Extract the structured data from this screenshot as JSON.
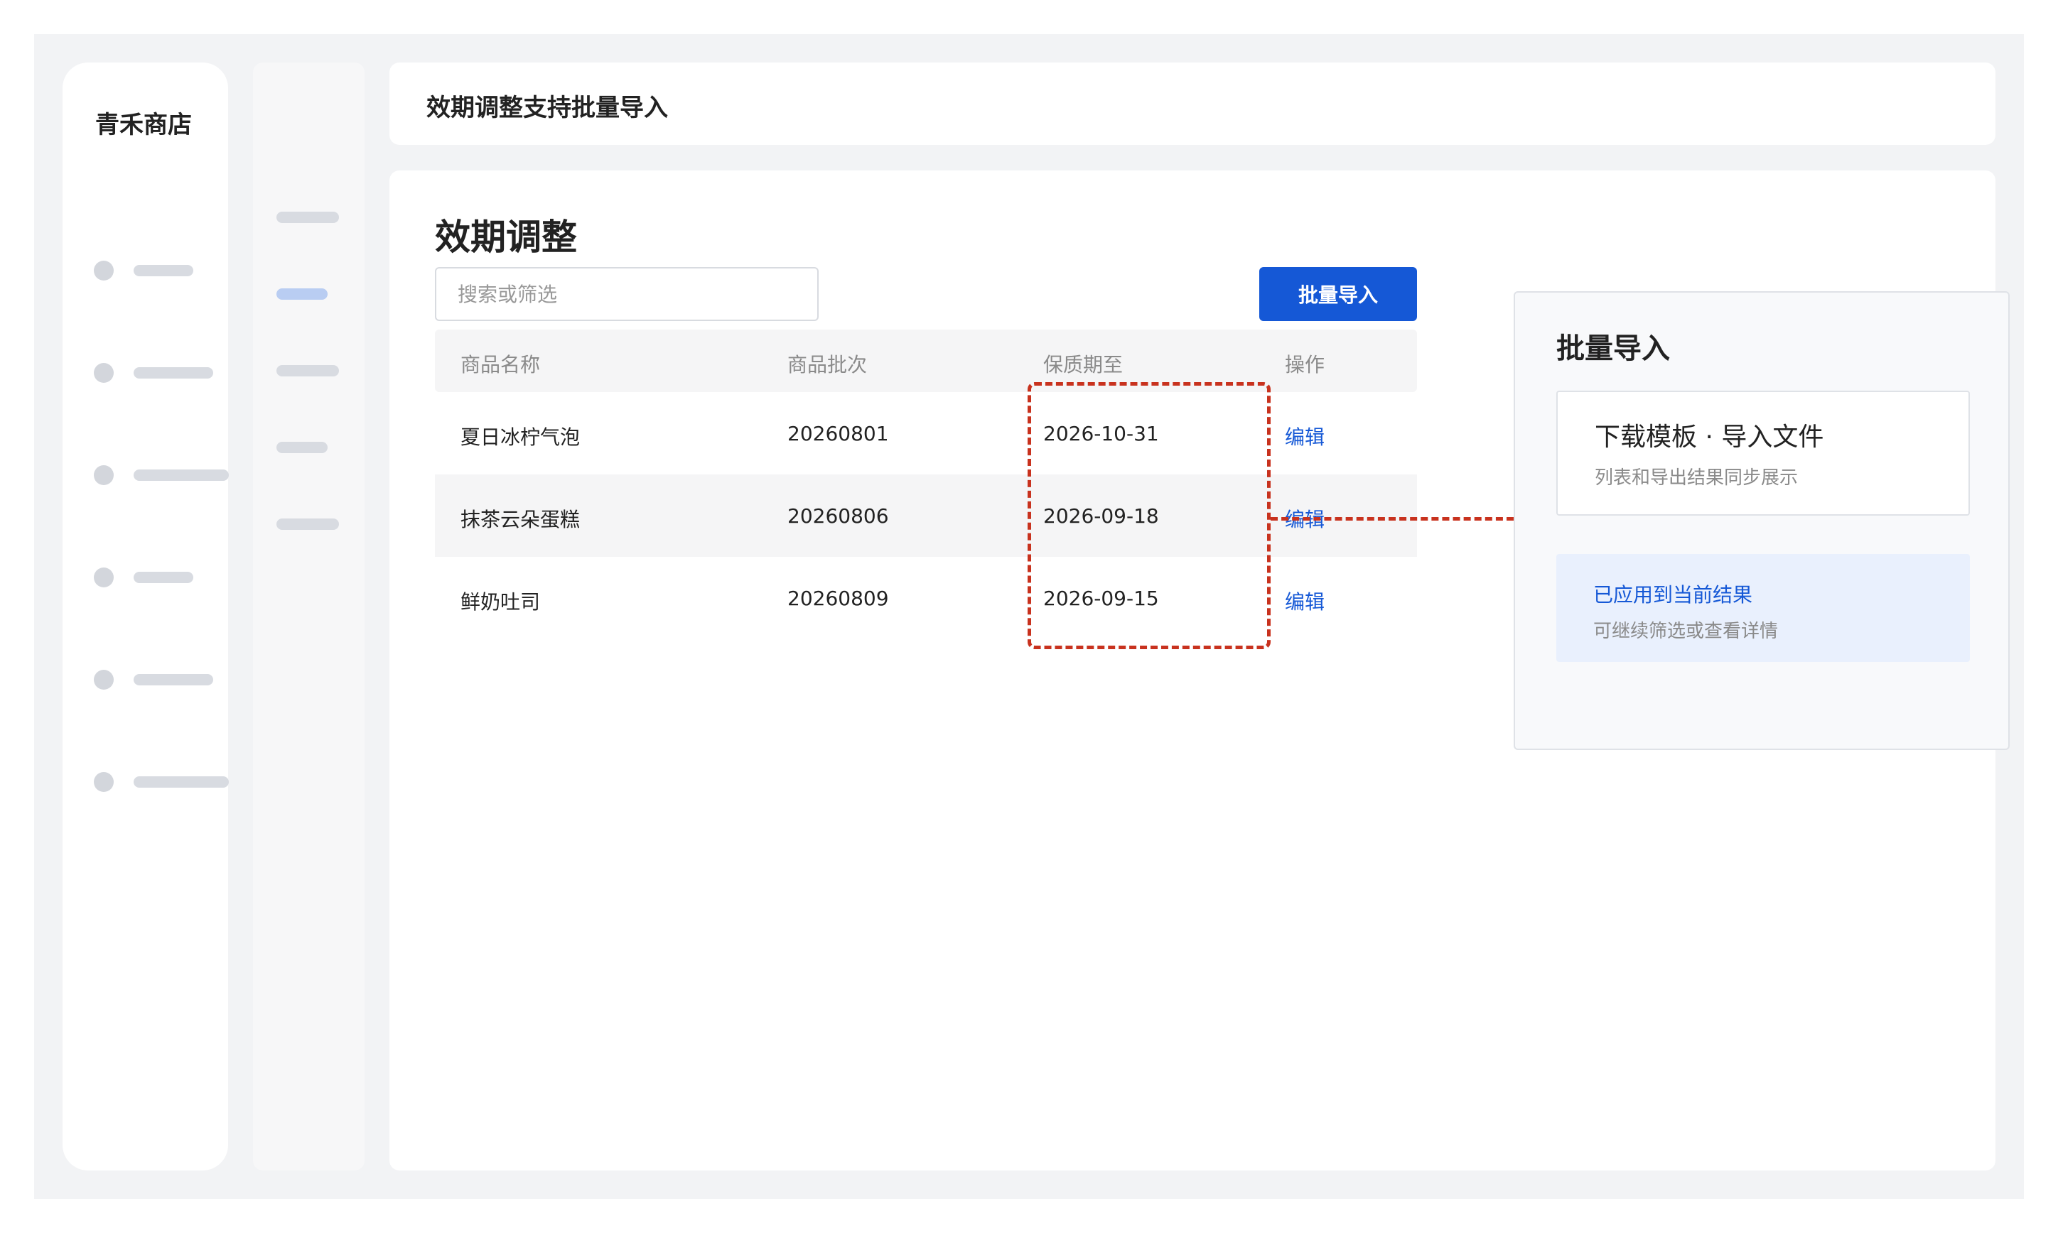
{
  "sidebar": {
    "brand": "青禾商店"
  },
  "header": {
    "title": "效期调整支持批量导入"
  },
  "main": {
    "page_title": "效期调整",
    "search": {
      "placeholder": "搜索或筛选",
      "value": ""
    },
    "import_button": "批量导入",
    "table": {
      "columns": [
        "商品名称",
        "商品批次",
        "保质期至",
        "操作"
      ],
      "rows": [
        {
          "name": "夏日冰柠气泡",
          "batch": "20260801",
          "expiry": "2026-10-31",
          "action": "编辑"
        },
        {
          "name": "抹茶云朵蛋糕",
          "batch": "20260806",
          "expiry": "2026-09-18",
          "action": "编辑"
        },
        {
          "name": "鲜奶吐司",
          "batch": "20260809",
          "expiry": "2026-09-15",
          "action": "编辑"
        }
      ]
    }
  },
  "panel": {
    "title": "批量导入",
    "card": {
      "title": "下载模板 · 导入文件",
      "subtitle": "列表和导出结果同步展示"
    },
    "status": {
      "title": "已应用到当前结果",
      "subtitle": "可继续筛选或查看详情"
    }
  },
  "colors": {
    "accent": "#1558d6",
    "highlight": "#c8321e"
  }
}
